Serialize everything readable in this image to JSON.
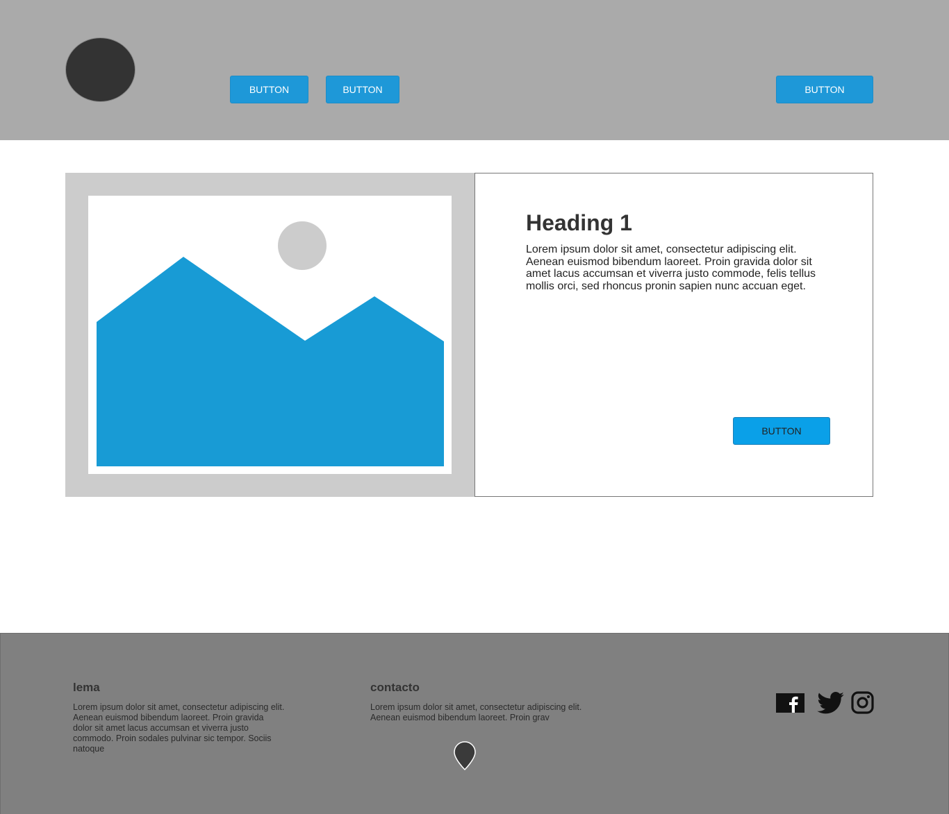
{
  "header": {
    "nav_buttons": [
      {
        "label": "BUTTON"
      },
      {
        "label": "BUTTON"
      },
      {
        "label": "BUTTON"
      }
    ]
  },
  "main": {
    "heading": "Heading 1",
    "body": "Lorem ipsum dolor sit amet, consectetur adipiscing elit. Aenean euismod bibendum laoreet. Proin gravida dolor sit amet lacus accumsan et viverra justo commode, felis tellus mollis orci, sed rhoncus pronin sapien nunc accuan eget.",
    "button_label": "BUTTON"
  },
  "footer": {
    "lema": {
      "title": "lema",
      "text": "Lorem ipsum dolor sit amet, consectetur adipiscing elit. Aenean euismod bibendum laoreet. Proin gravida dolor sit amet lacus accumsan et viverra justo commodo. Proin sodales pulvinar sic tempor. Sociis natoque"
    },
    "contacto": {
      "title": "contacto",
      "text": "Lorem ipsum dolor sit amet, consectetur adipiscing elit. Aenean euismod bibendum laoreet. Proin grav"
    },
    "social_icons": [
      "facebook-icon",
      "twitter-icon",
      "instagram-icon"
    ],
    "location_icon": "map-pin-icon"
  },
  "colors": {
    "header_bg": "#aaaaaa",
    "footer_bg": "#808080",
    "accent_blue": "#1e98d8",
    "image_blue": "#189bd5",
    "placeholder_gray": "#cccccc",
    "logo_dark": "#333333"
  }
}
